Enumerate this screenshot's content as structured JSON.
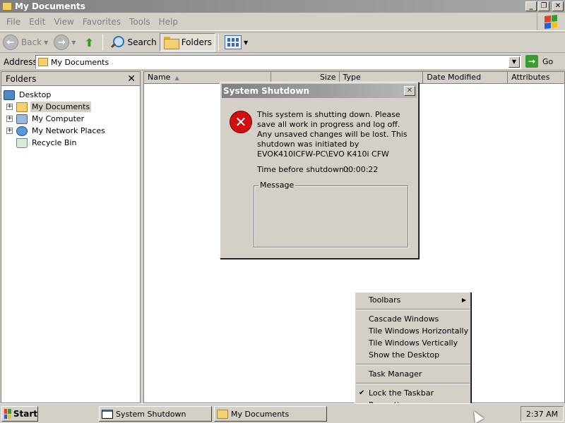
{
  "window": {
    "title": "My Documents"
  },
  "menubar": {
    "items": [
      "File",
      "Edit",
      "View",
      "Favorites",
      "Tools",
      "Help"
    ]
  },
  "toolbar": {
    "back": "Back",
    "search": "Search",
    "folders": "Folders"
  },
  "address": {
    "label": "Address",
    "value": "My Documents",
    "go": "Go"
  },
  "folders_pane": {
    "title": "Folders",
    "tree": [
      {
        "label": "Desktop",
        "icon": "desktop-icon",
        "level": 0
      },
      {
        "label": "My Documents",
        "icon": "my-documents-icon",
        "level": 1,
        "expander": "+",
        "selected": true
      },
      {
        "label": "My Computer",
        "icon": "my-computer-icon",
        "level": 1,
        "expander": "+"
      },
      {
        "label": "My Network Places",
        "icon": "network-places-icon",
        "level": 1,
        "expander": "+"
      },
      {
        "label": "Recycle Bin",
        "icon": "recycle-bin-icon",
        "level": 1,
        "expander": ""
      }
    ]
  },
  "file_list": {
    "columns": [
      "Name",
      "Size",
      "Type",
      "Date Modified",
      "Attributes"
    ]
  },
  "dialog": {
    "title": "System Shutdown",
    "message": "This system is shutting down. Please save all work in progress and log off. Any unsaved changes will be lost. This shutdown was initiated by EVOK410ICFW-PC\\EVO K410i CFW",
    "time_label": "Time before shutdown :",
    "time_value": "00:00:22",
    "message_group": "Message"
  },
  "context_menu": {
    "items": [
      {
        "label": "Toolbars",
        "submenu": true
      },
      {
        "separator": true
      },
      {
        "label": "Cascade Windows"
      },
      {
        "label": "Tile Windows Horizontally"
      },
      {
        "label": "Tile Windows Vertically"
      },
      {
        "label": "Show the Desktop"
      },
      {
        "separator": true
      },
      {
        "label": "Task Manager"
      },
      {
        "separator": true
      },
      {
        "label": "Lock the Taskbar",
        "checked": true
      },
      {
        "label": "Properties"
      }
    ]
  },
  "taskbar": {
    "start": "Start",
    "tasks": [
      "System Shutdown",
      "My Documents"
    ],
    "clock": "2:37 AM"
  }
}
